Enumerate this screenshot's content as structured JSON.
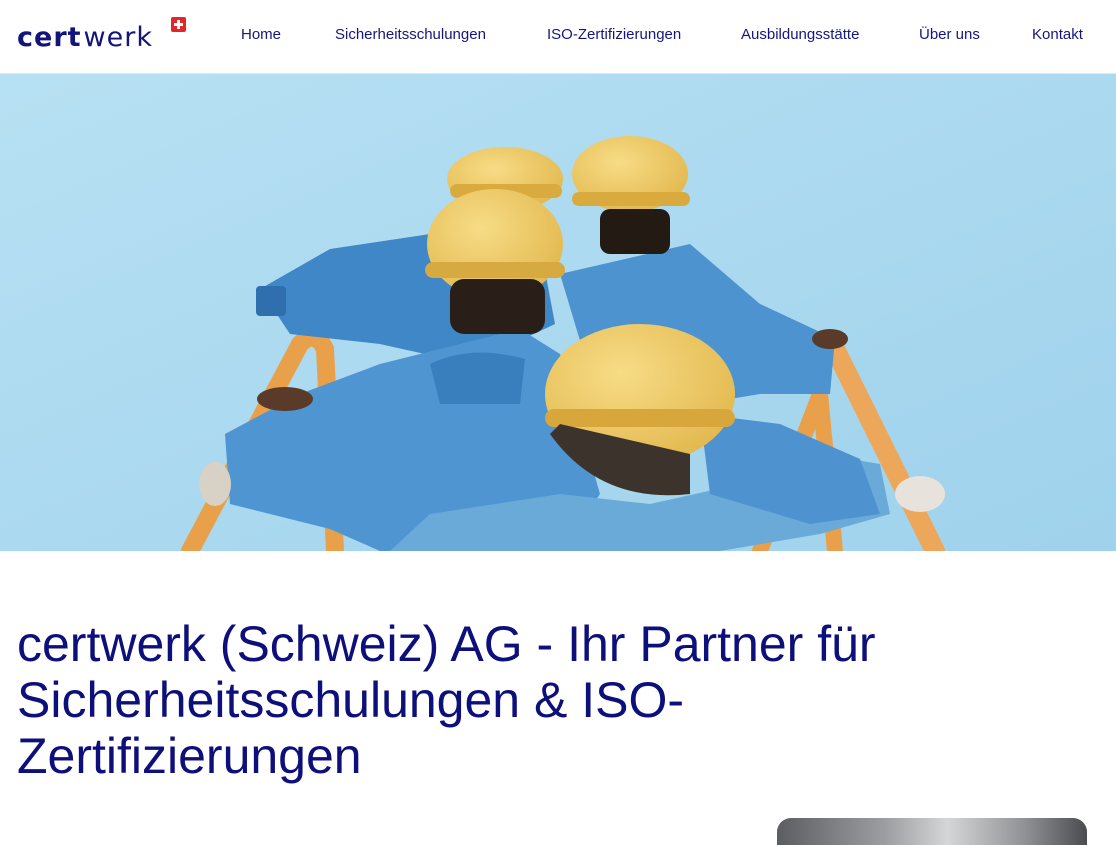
{
  "brand": {
    "logo_part1": "cert",
    "logo_part2": "werk",
    "flag_icon": "swiss-flag-icon"
  },
  "nav": {
    "items": [
      {
        "label": "Home"
      },
      {
        "label": "Sicherheitsschulungen"
      },
      {
        "label": "ISO-Zertifizierungen"
      },
      {
        "label": "Ausbildungsstätte"
      },
      {
        "label": "Über uns"
      },
      {
        "label": "Kontakt"
      }
    ]
  },
  "hero": {
    "image": "workers-hard-hats-ladder-photo"
  },
  "main": {
    "headline": "certwerk (Schweiz) AG - Ihr Partner für Sicherheitsschulungen & ISO-Zertifizierungen"
  },
  "colors": {
    "brand_navy": "#0d0f7a",
    "swiss_red": "#e3262b",
    "sky": "#a9d8ef"
  }
}
